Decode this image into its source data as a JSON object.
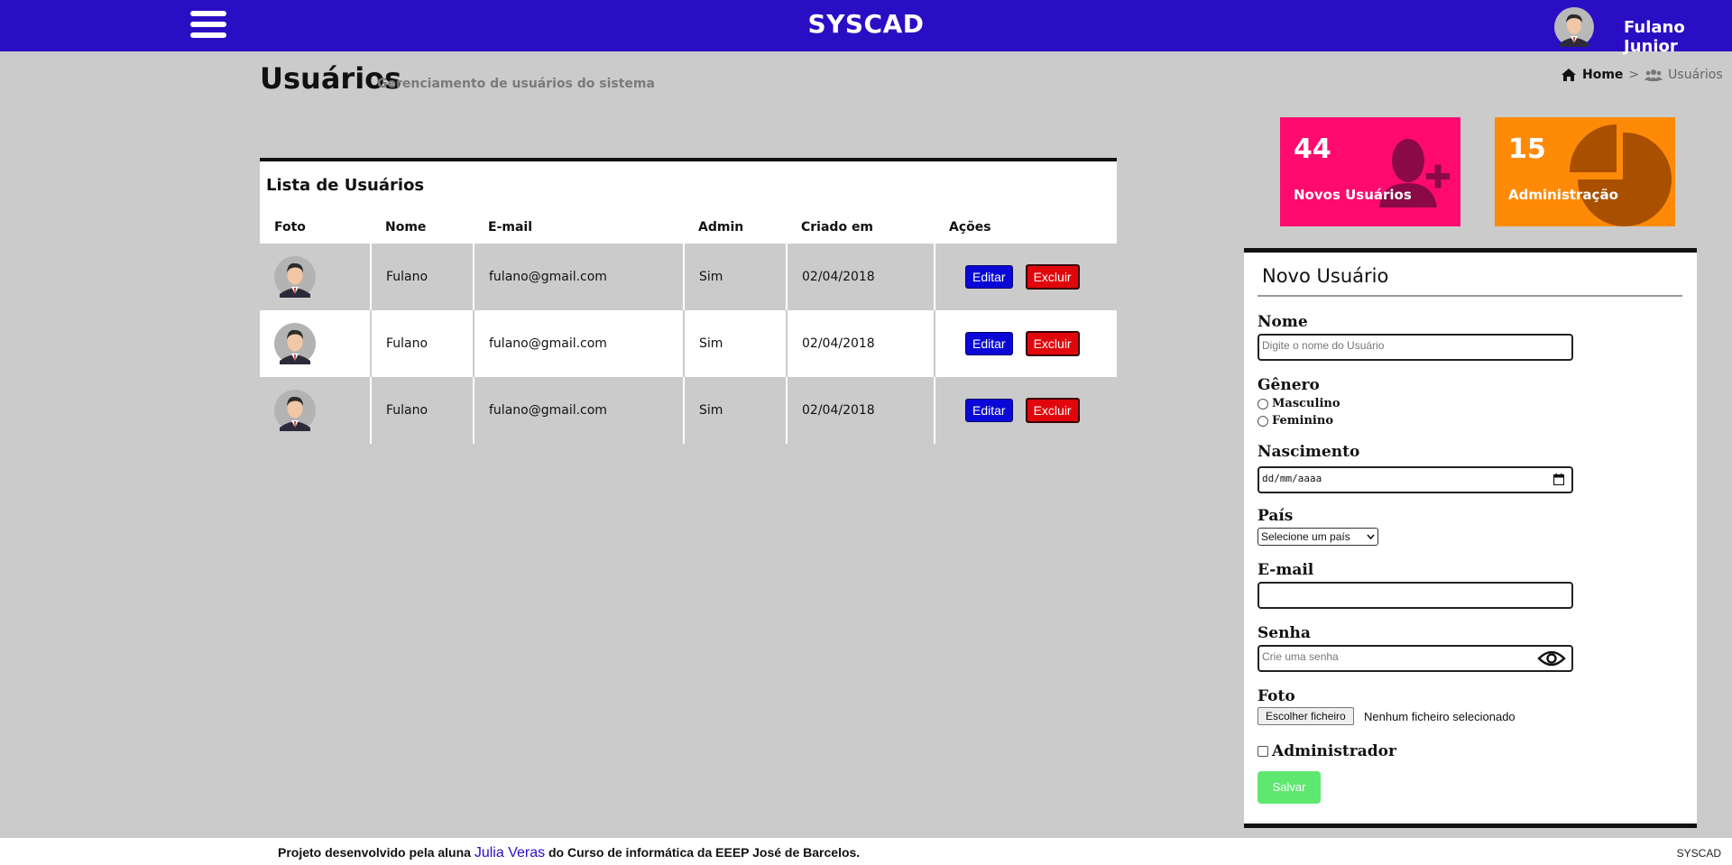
{
  "app": {
    "title": "SYSCAD",
    "user_name": "Fulano Junior"
  },
  "header": {
    "title": "Usuários",
    "subtitle": "Gerenciamento de usuários do sistema",
    "breadcrumb": {
      "home": "Home",
      "separator": ">",
      "current": "Usuários"
    }
  },
  "table": {
    "title": "Lista de Usuários",
    "columns": [
      "Foto",
      "Nome",
      "E-mail",
      "Admin",
      "Criado em",
      "Ações"
    ],
    "rows": [
      {
        "nome": "Fulano",
        "email": "fulano@gmail.com",
        "admin": "Sim",
        "criado": "02/04/2018",
        "edit": "Editar",
        "delete": "Excluir"
      },
      {
        "nome": "Fulano",
        "email": "fulano@gmail.com",
        "admin": "Sim",
        "criado": "02/04/2018",
        "edit": "Editar",
        "delete": "Excluir"
      },
      {
        "nome": "Fulano",
        "email": "fulano@gmail.com",
        "admin": "Sim",
        "criado": "02/04/2018",
        "edit": "Editar",
        "delete": "Excluir"
      }
    ]
  },
  "tiles": [
    {
      "value": "44",
      "label": "Novos Usuários",
      "color": "#ff0a6e",
      "icon": "add-user-icon"
    },
    {
      "value": "15",
      "label": "Administração",
      "color": "#ff8a08",
      "icon": "pie-chart-icon"
    }
  ],
  "form": {
    "title": "Novo Usuário",
    "nome_label": "Nome",
    "nome_placeholder": "Digite o nome do Usuário",
    "genero_label": "Gênero",
    "genero_options": [
      "Masculino",
      "Feminino"
    ],
    "nascimento_label": "Nascimento",
    "nascimento_placeholder": "dd/mm/aaaa",
    "pais_label": "País",
    "pais_selected": "Selecione um país",
    "email_label": "E-mail",
    "email_value": "",
    "senha_label": "Senha",
    "senha_placeholder": "Crie uma senha",
    "foto_label": "Foto",
    "file_button": "Escolher ficheiro",
    "file_status": "Nenhum ficheiro selecionado",
    "admin_label": "Administrador",
    "save_label": "Salvar"
  },
  "footer": {
    "prefix": "Projeto desenvolvido pela aluna",
    "author": "Julia Veras",
    "suffix": "do Curso de informática da EEEP José de Barcelos.",
    "brand": "SYSCAD"
  }
}
